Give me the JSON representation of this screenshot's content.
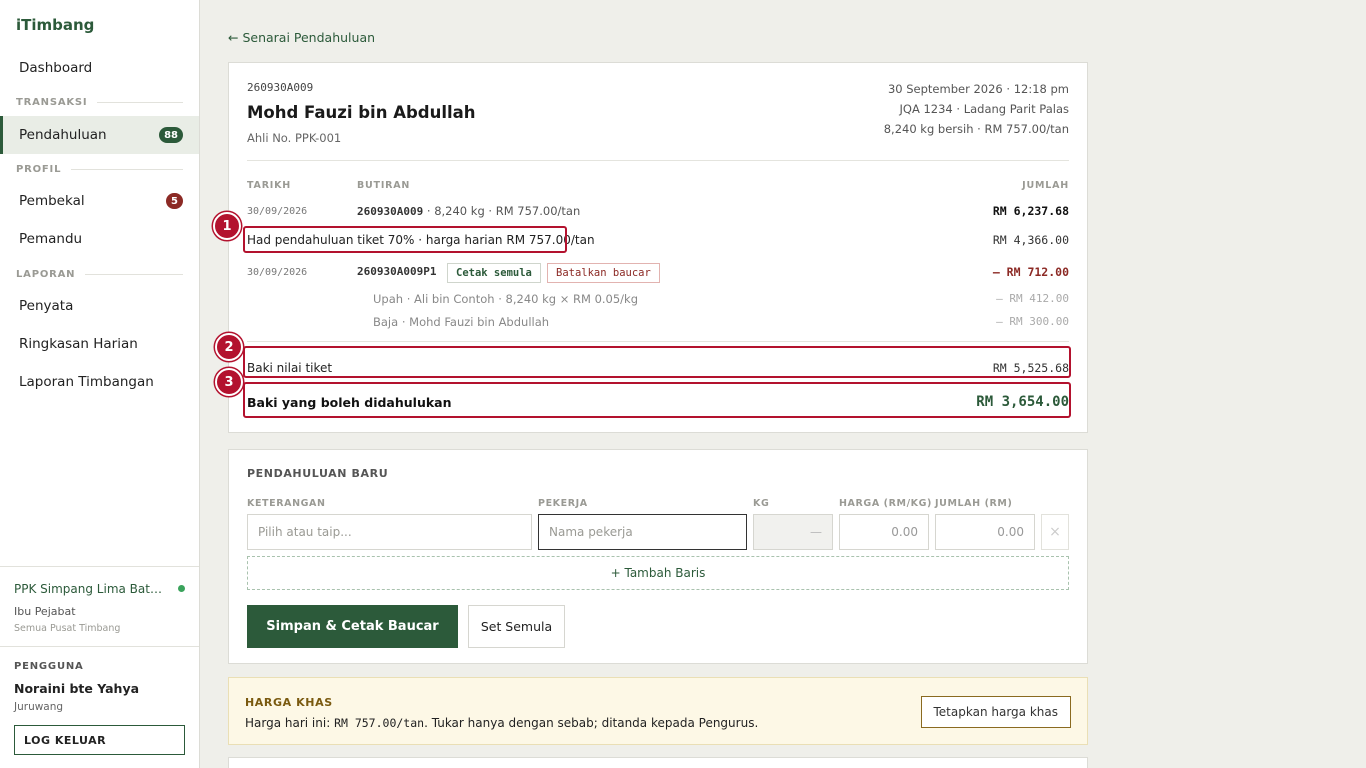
{
  "sidebar": {
    "brand": "iTimbang",
    "dashboard": "Dashboard",
    "section_transaksi": "TRANSAKSI",
    "pendahuluan": "Pendahuluan",
    "pendahuluan_badge": "88",
    "section_profil": "PROFIL",
    "pembekal": "Pembekal",
    "pembekal_badge": "5",
    "pemandu": "Pemandu",
    "section_laporan": "LAPORAN",
    "penyata": "Penyata",
    "ringkasan": "Ringkasan Harian",
    "laporan_timbangan": "Laporan Timbangan",
    "org_name": "PPK Simpang Lima Batu Pahat",
    "org_sub": "Ibu Pejabat",
    "org_sub2": "Semua Pusat Timbang",
    "user_label": "PENGGUNA",
    "user_name": "Noraini bte Yahya",
    "user_role": "Juruwang",
    "logout": "LOG KELUAR"
  },
  "main": {
    "back_link": "← Senarai Pendahuluan",
    "ticket": {
      "id": "260930A009",
      "name": "Mohd Fauzi bin Abdullah",
      "member": "Ahli No. PPK-001",
      "datetime": "30 September 2026 · 12:18 pm",
      "vehicle": "JQA 1234 · Ladang Parit Palas",
      "weight": "8,240 kg bersih · RM 757.00/tan"
    },
    "table": {
      "col_date": "TARIKH",
      "col_detail": "BUTIRAN",
      "col_amount": "JUMLAH",
      "row1_date": "30/09/2026",
      "row1_id": "260930A009",
      "row1_detail": " · 8,240 kg · RM 757.00/tan",
      "row1_amount": "RM 6,237.68",
      "limit_text": "Had pendahuluan tiket 70% · harga harian RM 757.00/tan",
      "limit_amount": "RM 4,366.00",
      "row2_date": "30/09/2026",
      "row2_id": "260930A009P1",
      "row2_reprint": "Cetak semula",
      "row2_cancel": "Batalkan baucar",
      "row2_amount": "– RM 712.00",
      "sub1_text": "Upah · Ali bin Contoh · 8,240 kg × RM 0.05/kg",
      "sub1_amount": "– RM 412.00",
      "sub2_text": "Baja · Mohd Fauzi bin Abdullah",
      "sub2_amount": "– RM 300.00",
      "balance_label": "Baki nilai tiket",
      "balance_amount": "RM 5,525.68",
      "advance_label": "Baki yang boleh didahulukan",
      "advance_amount": "RM 3,654.00"
    },
    "markers": [
      "1",
      "2",
      "3"
    ],
    "new_advance": {
      "title": "PENDAHULUAN BARU",
      "label_desc": "KETERANGAN",
      "label_worker": "PEKERJA",
      "label_kg": "KG",
      "label_price": "HARGA (RM/KG)",
      "label_total": "JUMLAH (RM)",
      "ph_desc": "Pilih atau taip...",
      "ph_worker": "Nama pekerja",
      "kg_value": "—",
      "price_value": "0.00",
      "total_value": "0.00",
      "remove": "×",
      "add_row": "+ Tambah Baris",
      "save": "Simpan & Cetak Baucar",
      "reset": "Set Semula"
    },
    "notice": {
      "title": "HARGA KHAS",
      "text_prefix": "Harga hari ini: ",
      "price": "RM 757.00/tan",
      "text_suffix": ". Tukar hanya dengan sebab; ditanda kepada Pengurus.",
      "button": "Tetapkan harga khas"
    }
  }
}
